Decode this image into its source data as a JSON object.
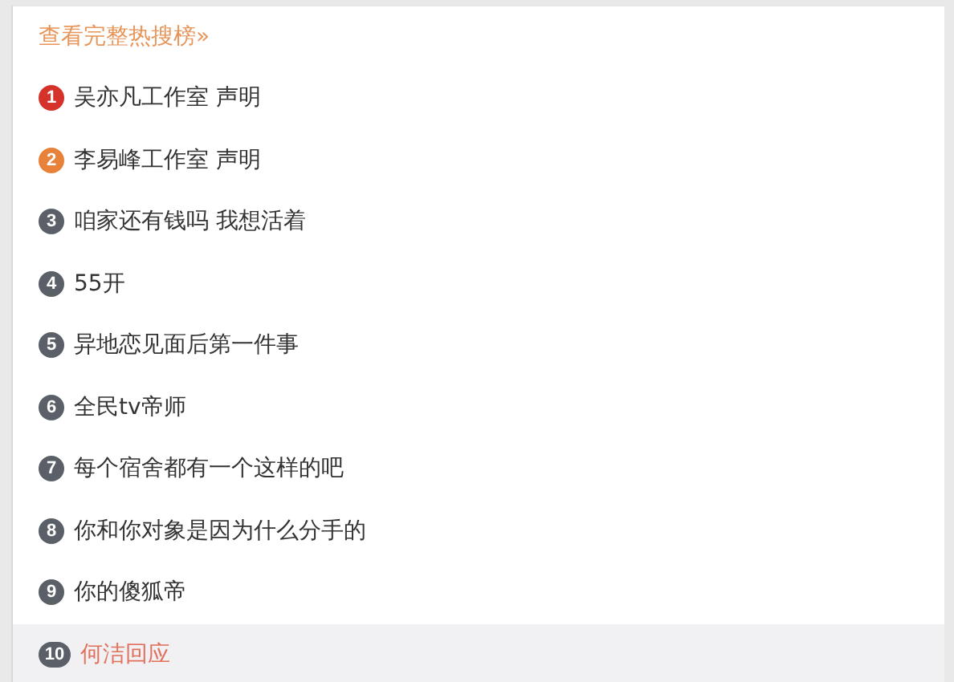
{
  "link": "查看完整热搜榜»",
  "items": [
    {
      "rank": "1",
      "text": "吴亦凡工作室 声明",
      "color": "#d6322c",
      "selected": false
    },
    {
      "rank": "2",
      "text": "李易峰工作室 声明",
      "color": "#e8823a",
      "selected": false
    },
    {
      "rank": "3",
      "text": "咱家还有钱吗 我想活着",
      "color": "#5b6068",
      "selected": false
    },
    {
      "rank": "4",
      "text": "55开",
      "color": "#5b6068",
      "selected": false
    },
    {
      "rank": "5",
      "text": "异地恋见面后第一件事",
      "color": "#5b6068",
      "selected": false
    },
    {
      "rank": "6",
      "text": "全民tv帝师",
      "color": "#5b6068",
      "selected": false
    },
    {
      "rank": "7",
      "text": "每个宿舍都有一个这样的吧",
      "color": "#5b6068",
      "selected": false
    },
    {
      "rank": "8",
      "text": "你和你对象是因为什么分手的",
      "color": "#5b6068",
      "selected": false
    },
    {
      "rank": "9",
      "text": "你的傻狐帝",
      "color": "#5b6068",
      "selected": false
    },
    {
      "rank": "10",
      "text": "何洁回应",
      "color": "#5b6068",
      "selected": true
    }
  ]
}
